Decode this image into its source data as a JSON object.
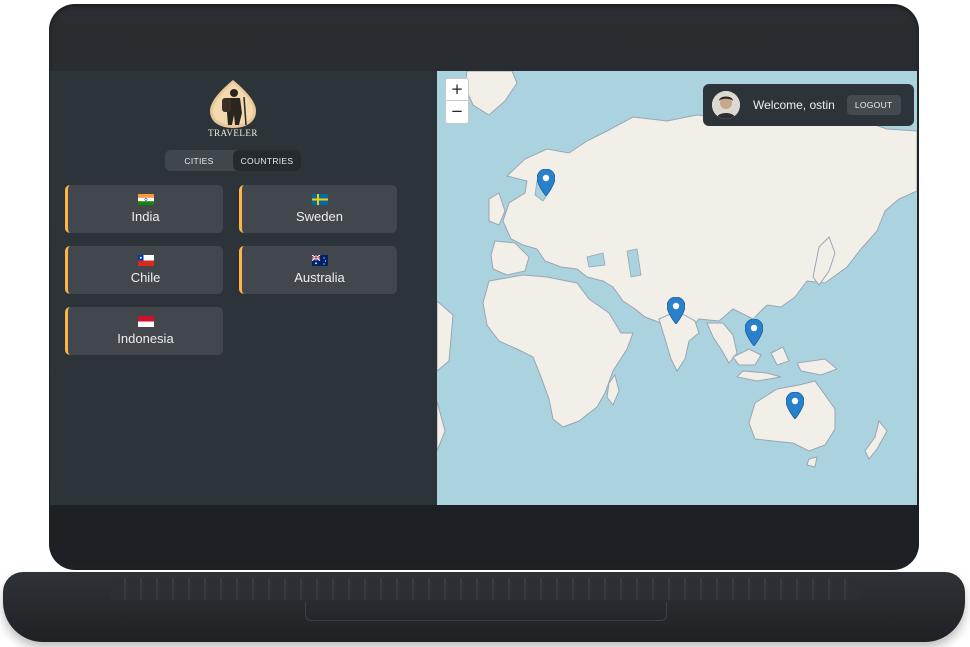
{
  "app": {
    "logo_text": "TRAVELER"
  },
  "tabs": [
    {
      "label": "CITIES",
      "active": false
    },
    {
      "label": "COUNTRIES",
      "active": true
    }
  ],
  "countries": [
    {
      "name": "India",
      "flag": "india"
    },
    {
      "name": "Sweden",
      "flag": "sweden"
    },
    {
      "name": "Chile",
      "flag": "chile"
    },
    {
      "name": "Australia",
      "flag": "australia"
    },
    {
      "name": "Indonesia",
      "flag": "indonesia"
    }
  ],
  "map": {
    "zoom_in": "+",
    "zoom_out": "−",
    "markers": [
      "Sweden",
      "India",
      "Indonesia",
      "Australia"
    ]
  },
  "user": {
    "welcome": "Welcome, ostin",
    "logout_label": "LOGOUT"
  },
  "colors": {
    "accent": "#ffb545",
    "sidebar_bg": "#2d3439",
    "card_bg": "#41474d",
    "water": "#aad3df",
    "land": "#f2efe9",
    "marker": "#2a81cb"
  }
}
